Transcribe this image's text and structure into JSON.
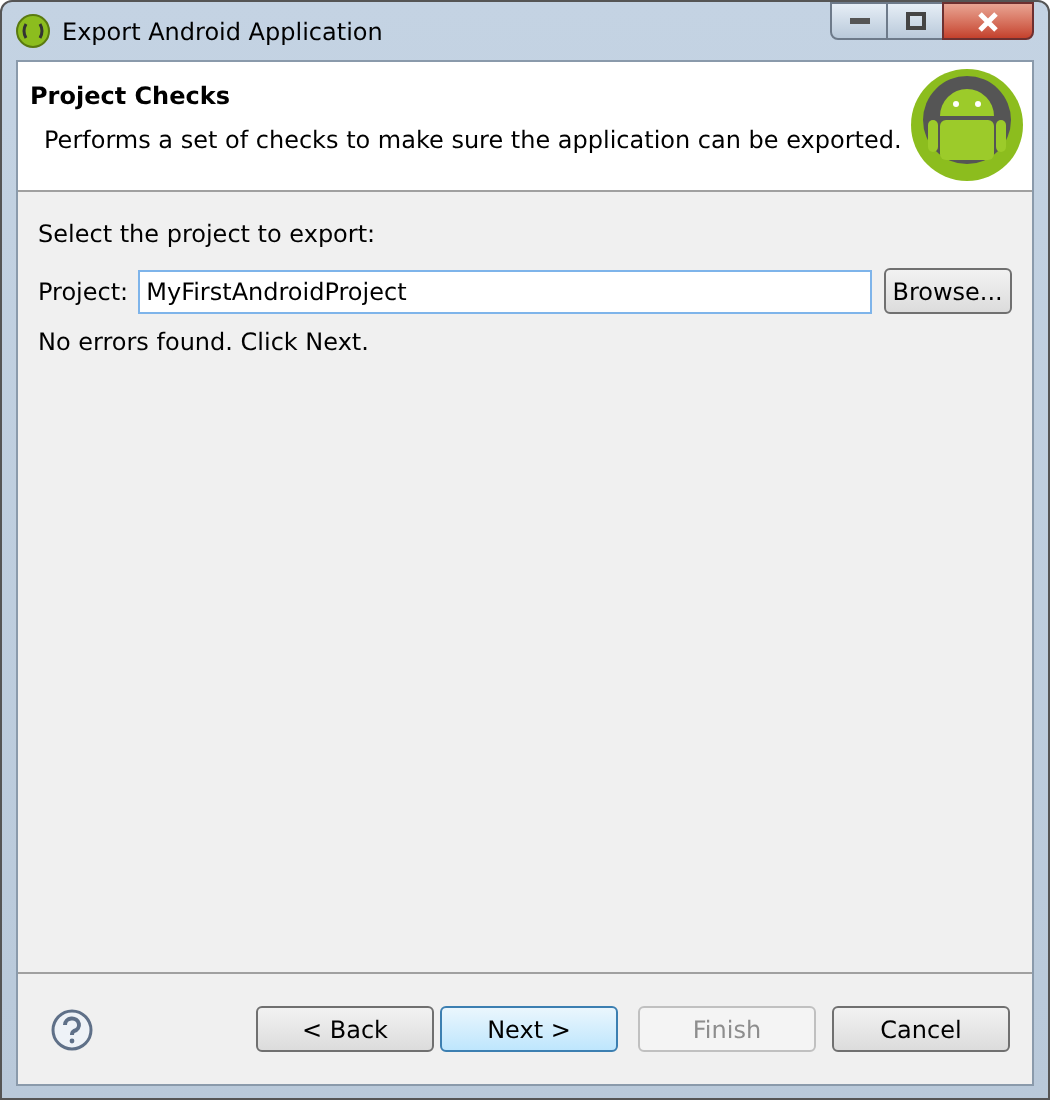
{
  "window": {
    "title": "Export Android Application"
  },
  "header": {
    "title": "Project Checks",
    "description": "Performs a set of checks to make sure the application can be exported."
  },
  "body": {
    "prompt": "Select the project to export:",
    "project_label": "Project:",
    "project_value": "MyFirstAndroidProject",
    "browse_button": "Browse...",
    "status": "No errors found. Click Next."
  },
  "buttons": [
    {
      "label": "< Back",
      "disabled": false,
      "default": false
    },
    {
      "label": "Next >",
      "disabled": false,
      "default": true
    },
    {
      "label": "Finish",
      "disabled": true,
      "default": false
    },
    {
      "label": "Cancel",
      "disabled": false,
      "default": false
    }
  ]
}
